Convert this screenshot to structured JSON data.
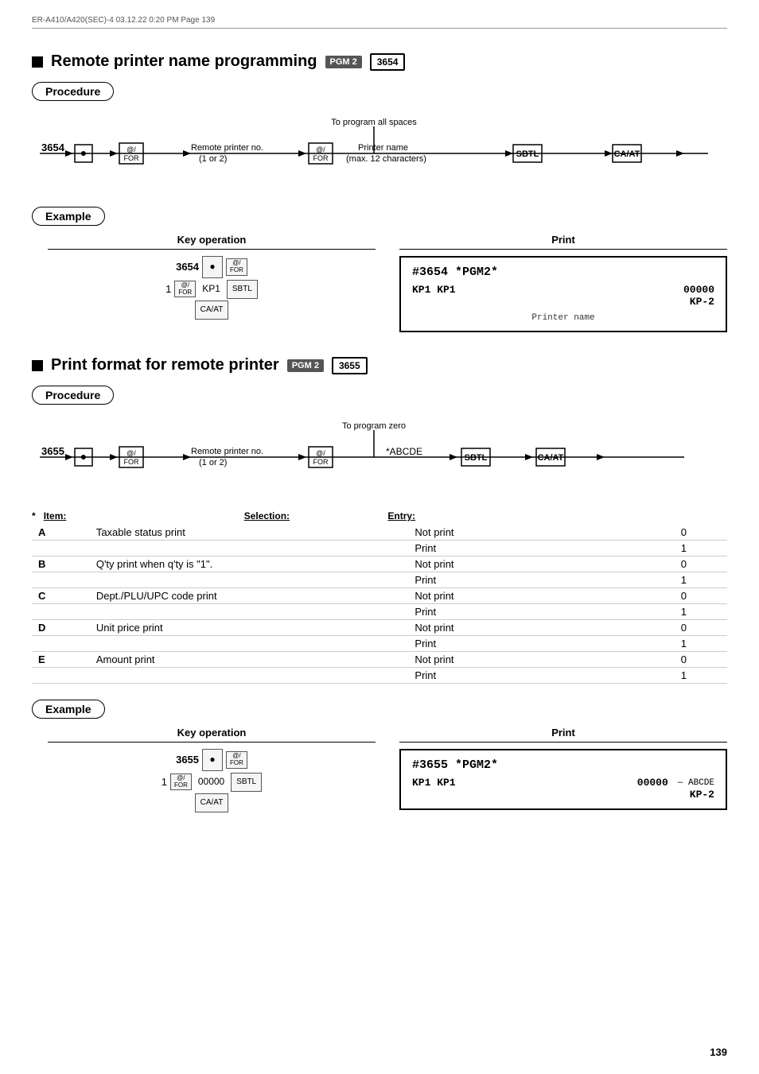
{
  "header": {
    "text": "ER-A410/A420(SEC)-4  03.12.22 0:20 PM  Page 139"
  },
  "section1": {
    "title": "Remote printer name programming",
    "badge1": "PGM 2",
    "badge2": "3654",
    "procedure_label": "Procedure",
    "flow": {
      "start_num": "3654",
      "dot": "●",
      "for_top": "@/",
      "for_bottom": "FOR",
      "remote_printer_no": "Remote printer no.",
      "remote_printer_sub": "(1 or 2)",
      "branch_label": "To program all spaces",
      "for2_top": "@/",
      "for2_bottom": "FOR",
      "printer_name": "Printer name",
      "printer_name_sub": "(max. 12 characters)",
      "sbtl": "SBTL",
      "caat": "CA/AT"
    },
    "example_label": "Example",
    "key_op_title": "Key operation",
    "print_title": "Print",
    "key_op": {
      "line1": "3654",
      "line2": "1",
      "kp1": "KP1",
      "ca_at": "CA/AT"
    },
    "print": {
      "line1": "#3654 *PGM2*",
      "line2": "KP1  KP1",
      "line3": "00000",
      "line4": "KP-2",
      "label": "Printer name"
    }
  },
  "section2": {
    "title": "Print format for remote printer",
    "badge1": "PGM 2",
    "badge2": "3655",
    "procedure_label": "Procedure",
    "flow": {
      "start_num": "3655",
      "dot": "●",
      "for_top": "@/",
      "for_bottom": "FOR",
      "remote_printer_no": "Remote printer no.",
      "remote_printer_sub": "(1 or 2)",
      "branch_label": "To program zero",
      "for2_top": "@/",
      "for2_bottom": "FOR",
      "abcde": "*ABCDE",
      "sbtl": "SBTL",
      "caat": "CA/AT"
    },
    "asterisk_note": "*  Item:",
    "table": {
      "headers": [
        "Item:",
        "Selection:",
        "Entry:"
      ],
      "rows": [
        {
          "item": "A",
          "desc": "Taxable status print",
          "sel": "Not print",
          "entry": "0"
        },
        {
          "item": "",
          "desc": "",
          "sel": "Print",
          "entry": "1"
        },
        {
          "item": "B",
          "desc": "Q'ty print when q'ty is \"1\".",
          "sel": "Not print",
          "entry": "0"
        },
        {
          "item": "",
          "desc": "",
          "sel": "Print",
          "entry": "1"
        },
        {
          "item": "C",
          "desc": "Dept./PLU/UPC code print",
          "sel": "Not print",
          "entry": "0"
        },
        {
          "item": "",
          "desc": "",
          "sel": "Print",
          "entry": "1"
        },
        {
          "item": "D",
          "desc": "Unit price print",
          "sel": "Not print",
          "entry": "0"
        },
        {
          "item": "",
          "desc": "",
          "sel": "Print",
          "entry": "1"
        },
        {
          "item": "E",
          "desc": "Amount print",
          "sel": "Not print",
          "entry": "0"
        },
        {
          "item": "",
          "desc": "",
          "sel": "Print",
          "entry": "1"
        }
      ]
    },
    "example_label": "Example",
    "key_op_title": "Key operation",
    "print_title": "Print",
    "key_op": {
      "line1": "3655",
      "line2": "1",
      "val": "00000",
      "sbtl": "SBTL",
      "ca_at": "CA/AT"
    },
    "print": {
      "line1": "#3655 *PGM2*",
      "line2": "KP1 KP1",
      "line3": "00000",
      "line4": "KP-2",
      "abcde": "ABCDE"
    }
  },
  "page_number": "139"
}
